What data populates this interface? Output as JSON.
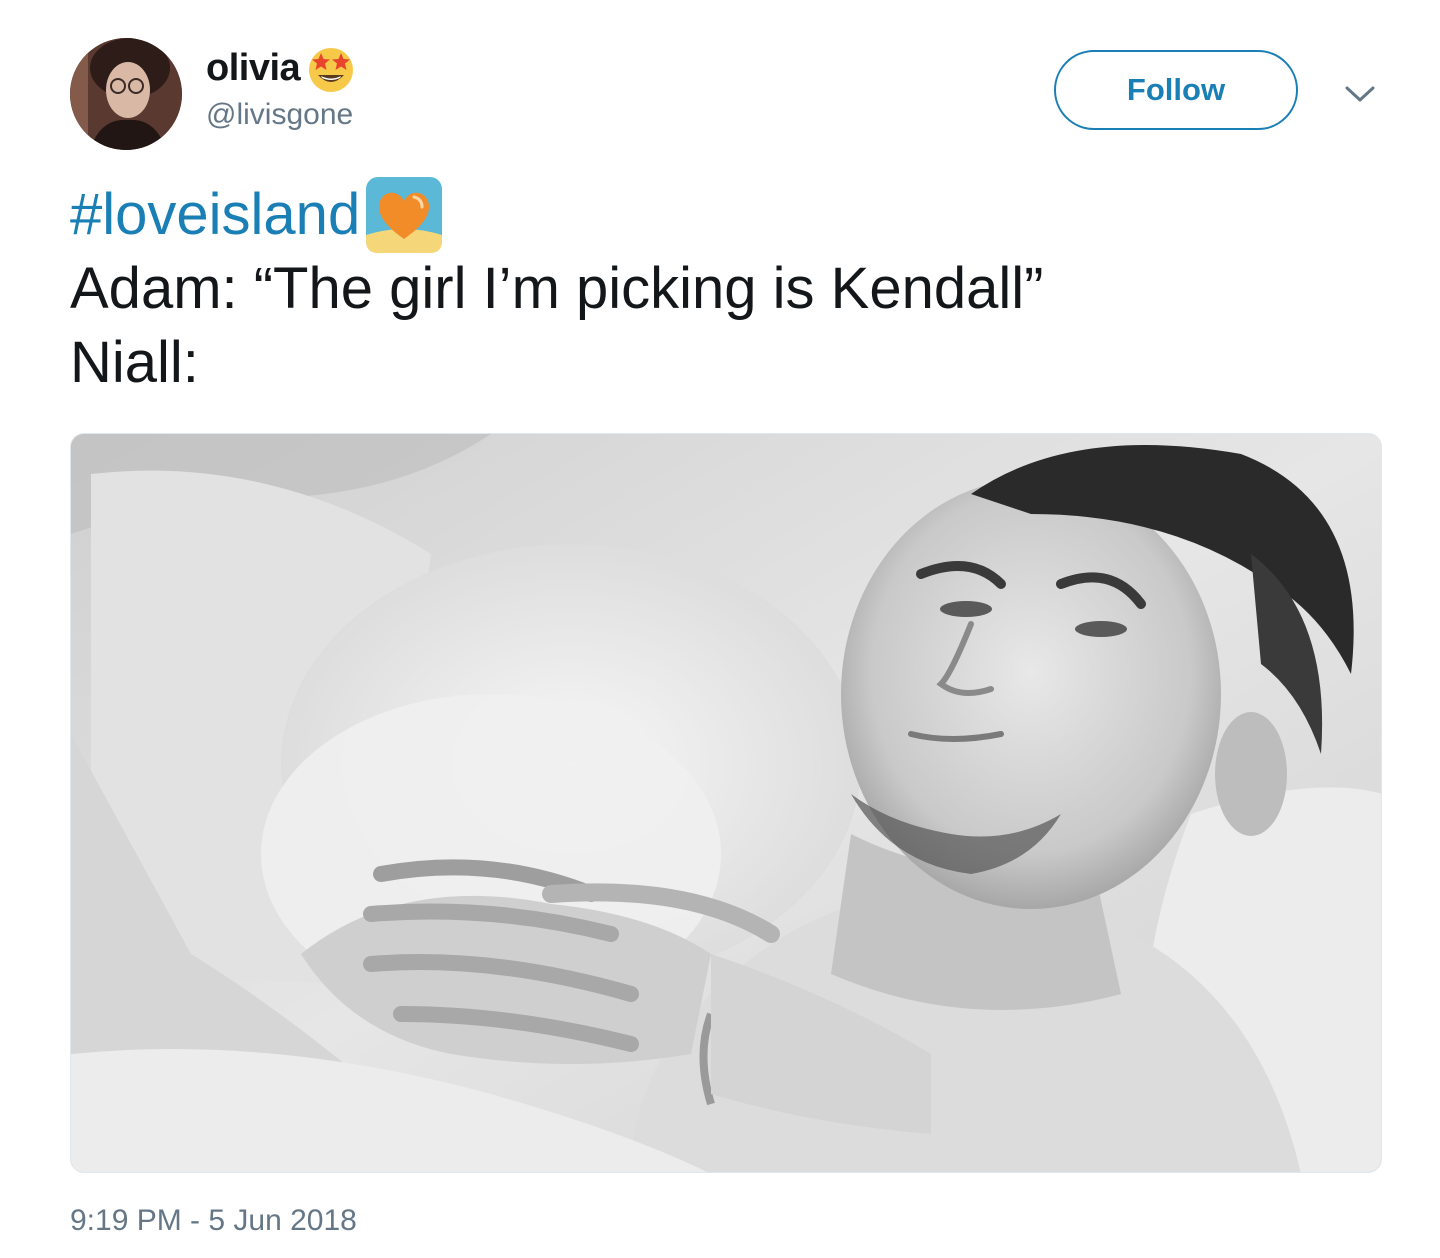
{
  "tweet": {
    "author": {
      "display_name": "olivia",
      "display_name_emoji": "star-struck-emoji",
      "handle": "@livisgone"
    },
    "follow_label": "Follow",
    "text": {
      "hashtag": "#loveisland",
      "hashtag_emoji": "heart-island-emoji",
      "line2": "Adam: “The girl I’m picking is Kendall”",
      "line3": "Niall:"
    },
    "timestamp": "9:19 PM - 5 Jun 2018"
  },
  "colors": {
    "link": "#1a7fb5",
    "text": "#14171a",
    "secondary": "#657786"
  }
}
